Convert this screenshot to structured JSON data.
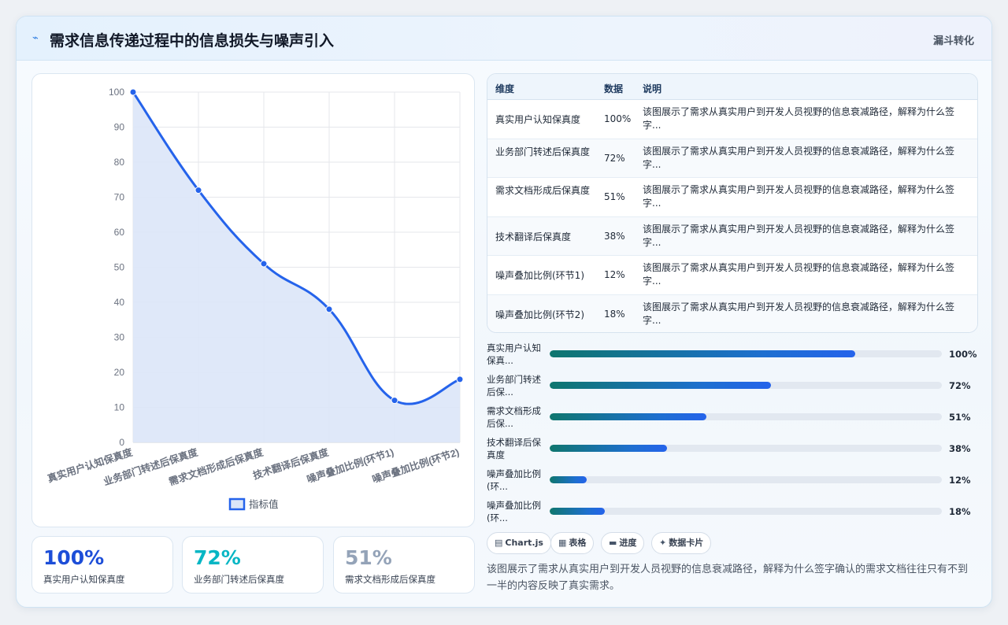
{
  "header": {
    "title": "需求信息传递过程中的信息损失与噪声引入",
    "badge": "漏斗转化",
    "icon": "lightning-icon"
  },
  "chart_data": {
    "type": "line",
    "categories": [
      "真实用户认知保真度",
      "业务部门转述后保真度",
      "需求文档形成后保真度",
      "技术翻译后保真度",
      "噪声叠加比例(环节1)",
      "噪声叠加比例(环节2)"
    ],
    "series": [
      {
        "name": "指标值",
        "values": [
          100,
          72,
          51,
          38,
          12,
          18
        ],
        "color": "#2563eb",
        "fill": "#dbe6f8"
      }
    ],
    "ylim": [
      0,
      100
    ],
    "yticks": [
      0,
      10,
      20,
      30,
      40,
      50,
      60,
      70,
      80,
      90,
      100
    ],
    "grid": true,
    "legend": "bottom"
  },
  "stats": [
    {
      "value": "100%",
      "label": "真实用户认知保真度",
      "color": "#1d4ed8"
    },
    {
      "value": "72%",
      "label": "业务部门转述后保真度",
      "color": "#06b6c4"
    },
    {
      "value": "51%",
      "label": "需求文档形成后保真度",
      "color": "#94a3b8"
    }
  ],
  "table": {
    "headers": {
      "dim": "维度",
      "val": "数据",
      "desc": "说明"
    },
    "rows": [
      {
        "dim": "真实用户认知保真度",
        "val": "100%",
        "desc": "该图展示了需求从真实用户到开发人员视野的信息衰减路径，解释为什么签字..."
      },
      {
        "dim": "业务部门转述后保真度",
        "val": "72%",
        "desc": "该图展示了需求从真实用户到开发人员视野的信息衰减路径，解释为什么签字..."
      },
      {
        "dim": "需求文档形成后保真度",
        "val": "51%",
        "desc": "该图展示了需求从真实用户到开发人员视野的信息衰减路径，解释为什么签字..."
      },
      {
        "dim": "技术翻译后保真度",
        "val": "38%",
        "desc": "该图展示了需求从真实用户到开发人员视野的信息衰减路径，解释为什么签字..."
      },
      {
        "dim": "噪声叠加比例(环节1)",
        "val": "12%",
        "desc": "该图展示了需求从真实用户到开发人员视野的信息衰减路径，解释为什么签字..."
      },
      {
        "dim": "噪声叠加比例(环节2)",
        "val": "18%",
        "desc": "该图展示了需求从真实用户到开发人员视野的信息衰减路径，解释为什么签字..."
      }
    ]
  },
  "bars": [
    {
      "label": "真实用户认知保真...",
      "value": "100%",
      "fill": 0.78
    },
    {
      "label": "业务部门转述后保...",
      "value": "72%",
      "fill": 0.565
    },
    {
      "label": "需求文档形成后保...",
      "value": "51%",
      "fill": 0.4
    },
    {
      "label": "技术翻译后保真度",
      "value": "38%",
      "fill": 0.3
    },
    {
      "label": "噪声叠加比例(环...",
      "value": "12%",
      "fill": 0.095
    },
    {
      "label": "噪声叠加比例(环...",
      "value": "18%",
      "fill": 0.14
    }
  ],
  "chips": [
    {
      "icon": "chart-icon",
      "glyph": "▤",
      "label": "Chart.js"
    },
    {
      "icon": "table-icon",
      "glyph": "▦",
      "label": "表格"
    },
    {
      "icon": "progress-icon",
      "glyph": "▬",
      "label": "进度"
    },
    {
      "icon": "sparkle-icon",
      "glyph": "✦",
      "label": "数据卡片"
    }
  ],
  "summary": "该图展示了需求从真实用户到开发人员视野的信息衰减路径，解释为什么签字确认的需求文档往往只有不到一半的内容反映了真实需求。"
}
